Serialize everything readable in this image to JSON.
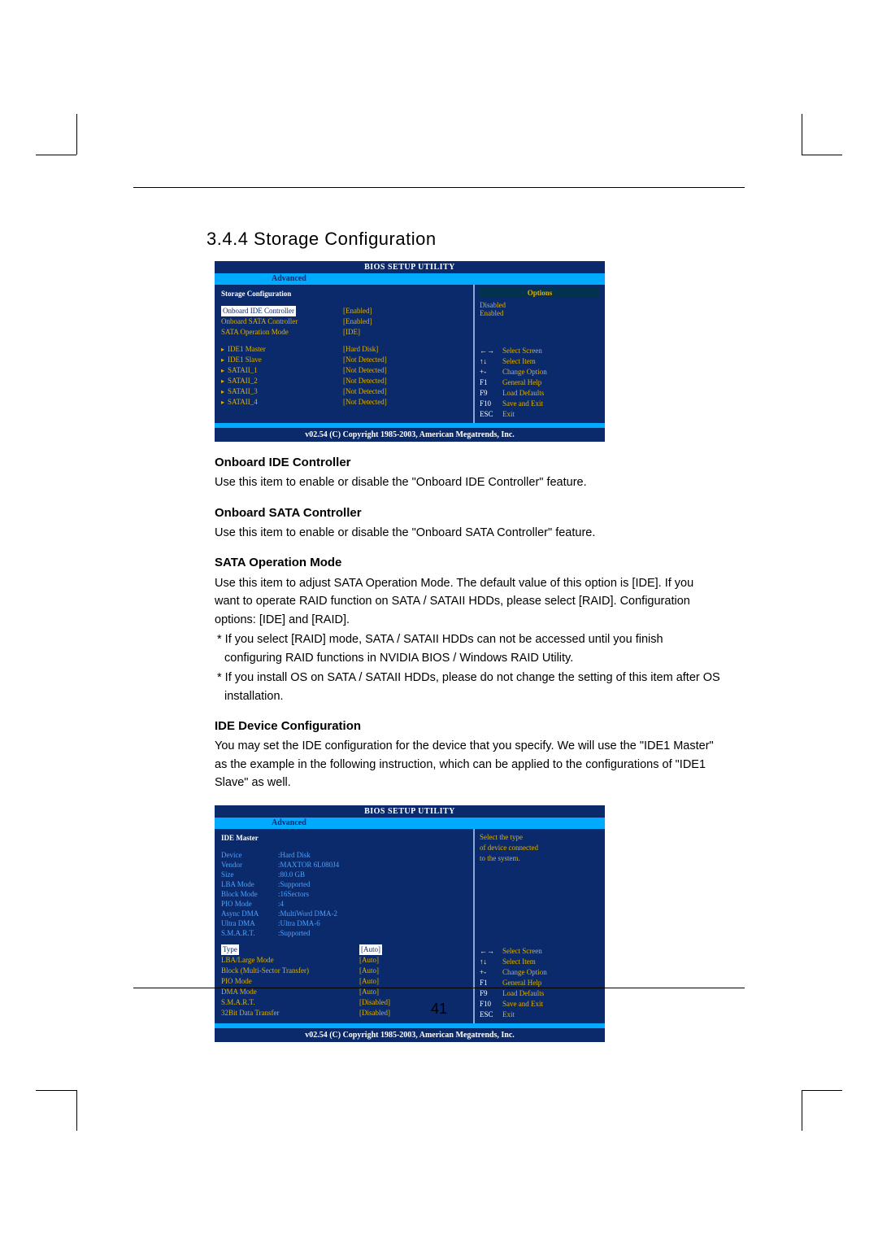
{
  "section_title": "3.4.4 Storage Configuration",
  "bios1": {
    "header": "BIOS SETUP UTILITY",
    "tab": "Advanced",
    "pane_title": "Storage Configuration",
    "rows_main": [
      {
        "label": "Onboard IDE Controller",
        "value": "[Enabled]",
        "selected": true
      },
      {
        "label": "Onboard SATA Controller",
        "value": "[Enabled]"
      },
      {
        "label": "SATA Operation Mode",
        "value": "[IDE]"
      }
    ],
    "rows_devices": [
      {
        "label": "IDE1 Master",
        "value": "[Hard Disk]"
      },
      {
        "label": "IDE1 Slave",
        "value": "[Not Detected]"
      },
      {
        "label": "SATAII_1",
        "value": "[Not Detected]"
      },
      {
        "label": "SATAII_2",
        "value": "[Not Detected]"
      },
      {
        "label": "SATAII_3",
        "value": "[Not Detected]"
      },
      {
        "label": "SATAII_4",
        "value": "[Not Detected]"
      }
    ],
    "options_title": "Options",
    "options": [
      "Disabled",
      "Enabled"
    ],
    "keys": [
      {
        "k": "←→",
        "a": "Select Screen"
      },
      {
        "k": "↑↓",
        "a": "Select Item"
      },
      {
        "k": "+-",
        "a": "Change Option"
      },
      {
        "k": "F1",
        "a": "General Help"
      },
      {
        "k": "F9",
        "a": "Load Defaults"
      },
      {
        "k": "F10",
        "a": "Save and Exit"
      },
      {
        "k": "ESC",
        "a": "Exit"
      }
    ],
    "footer": "v02.54 (C) Copyright 1985-2003, American Megatrends, Inc."
  },
  "content": {
    "h1": "Onboard IDE Controller",
    "p1": "Use this item to enable or disable the \"Onboard IDE Controller\" feature.",
    "h2": "Onboard SATA Controller",
    "p2": "Use this item to enable or disable the \"Onboard SATA Controller\" feature.",
    "h3": "SATA Operation Mode",
    "p3": "Use this item to adjust SATA Operation Mode. The default value of this option is [IDE]. If you want to operate RAID function on SATA / SATAII HDDs, please select [RAID]. Configuration options: [IDE] and [RAID].",
    "n1": "* If you select [RAID] mode, SATA / SATAII HDDs can not be accessed until you finish configuring RAID functions in NVIDIA BIOS / Windows RAID Utility.",
    "n2": "* If you install OS on SATA / SATAII HDDs, please do not change the setting of this item after OS installation.",
    "h4": "IDE Device Configuration",
    "p4": "You may set the IDE configuration for the device that you specify. We will use the \"IDE1 Master\" as the example in the following instruction, which can be applied to the configurations of \"IDE1 Slave\" as well."
  },
  "bios2": {
    "header": "BIOS SETUP UTILITY",
    "tab": "Advanced",
    "pane_title": "IDE Master",
    "info": [
      {
        "k": "Device",
        "v": ":Hard Disk"
      },
      {
        "k": "Vendor",
        "v": ":MAXTOR 6L080J4"
      },
      {
        "k": "Size",
        "v": ":80.0 GB"
      },
      {
        "k": "LBA Mode",
        "v": ":Supported"
      },
      {
        "k": "Block Mode",
        "v": ":16Sectors"
      },
      {
        "k": "PIO Mode",
        "v": ":4"
      },
      {
        "k": "Async DMA",
        "v": ":MultiWord DMA-2"
      },
      {
        "k": "Ultra DMA",
        "v": ":Ultra DMA-6"
      },
      {
        "k": "S.M.A.R.T.",
        "v": ":Supported"
      }
    ],
    "settings": [
      {
        "label": "Type",
        "value": "[Auto]",
        "selected": true
      },
      {
        "label": "LBA/Large Mode",
        "value": "[Auto]"
      },
      {
        "label": "Block (Multi-Sector Transfer)",
        "value": "[Auto]"
      },
      {
        "label": "PIO Mode",
        "value": "[Auto]"
      },
      {
        "label": "DMA Mode",
        "value": "[Auto]"
      },
      {
        "label": "S.M.A.R.T.",
        "value": "[Disabled]"
      },
      {
        "label": "32Bit Data Transfer",
        "value": "[Disabled]"
      }
    ],
    "help": [
      "Select the type",
      "of device connected",
      "to the system."
    ],
    "keys": [
      {
        "k": "←→",
        "a": "Select Screen"
      },
      {
        "k": "↑↓",
        "a": "Select Item"
      },
      {
        "k": "+-",
        "a": "Change Option"
      },
      {
        "k": "F1",
        "a": "General Help"
      },
      {
        "k": "F9",
        "a": "Load Defaults"
      },
      {
        "k": "F10",
        "a": "Save and Exit"
      },
      {
        "k": "ESC",
        "a": "Exit"
      }
    ],
    "footer": "v02.54 (C) Copyright 1985-2003, American Megatrends, Inc."
  },
  "page_number": "41"
}
